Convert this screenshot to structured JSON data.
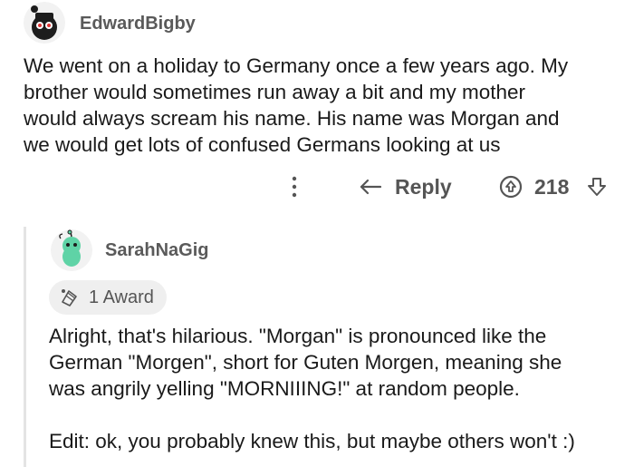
{
  "comment": {
    "username": "EdwardBigby",
    "body_lines": [
      "We went on a holiday to Germany once a few years ago. My",
      "brother would sometimes run away a bit and my mother",
      "would always scream his name. His name was Morgan and",
      "we would get lots of confused Germans looking at us"
    ],
    "reply_label": "Reply",
    "vote_count": "218",
    "icons": [
      "more-dots-icon",
      "reply-arrow-icon",
      "upvote-icon",
      "downvote-icon"
    ]
  },
  "reply": {
    "username": "SarahNaGig",
    "award_label": "1 Award",
    "body_lines": [
      "Alright, that's hilarious. \"Morgan\" is pronounced like the",
      "German \"Morgen\", short for Guten Morgen, meaning she",
      "was angrily yelling \"MORNIIING!\" at random people."
    ],
    "edit_line": "Edit: ok, you probably knew this, but maybe others won't :)",
    "icons": [
      "award-icon"
    ]
  },
  "colors": {
    "avatar_green": "#5fd3a6",
    "text": "#1a1a1a",
    "muted": "#555555",
    "award_bg": "#efefef"
  }
}
